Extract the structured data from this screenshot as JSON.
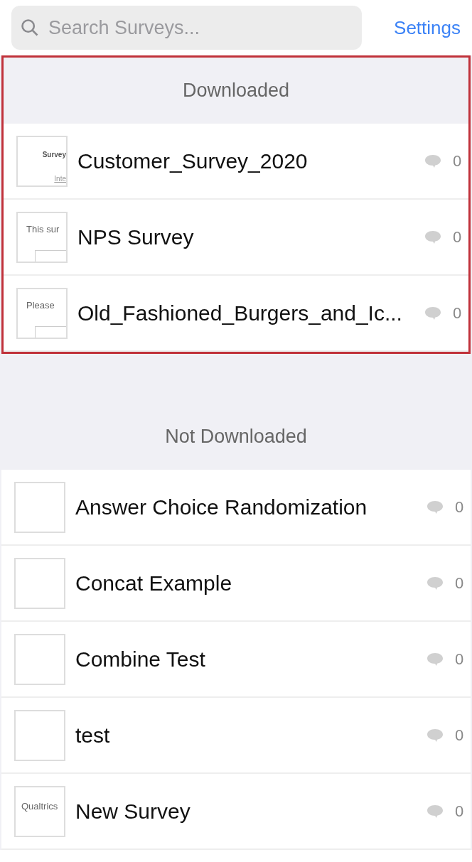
{
  "search": {
    "placeholder": "Search Surveys..."
  },
  "settings_link": "Settings",
  "sections": [
    {
      "title": "Downloaded",
      "highlighted": true,
      "surveys": [
        {
          "name": "Customer_Survey_2020",
          "comments": "0",
          "thumbnail": {
            "kind": "header",
            "lines": [
              "Survey",
              "Inte"
            ]
          }
        },
        {
          "name": "NPS Survey",
          "comments": "0",
          "thumbnail": {
            "kind": "form",
            "lines": [
              "This sur"
            ]
          }
        },
        {
          "name": "Old_Fashioned_Burgers_and_Ic...",
          "comments": "0",
          "thumbnail": {
            "kind": "form",
            "lines": [
              "Please"
            ]
          }
        }
      ]
    },
    {
      "title": "Not Downloaded",
      "highlighted": false,
      "surveys": [
        {
          "name": "Answer Choice Randomization",
          "comments": "0",
          "thumbnail": {
            "kind": "blank"
          }
        },
        {
          "name": "Concat Example",
          "comments": "0",
          "thumbnail": {
            "kind": "blank"
          }
        },
        {
          "name": "Combine Test",
          "comments": "0",
          "thumbnail": {
            "kind": "blank"
          }
        },
        {
          "name": "test",
          "comments": "0",
          "thumbnail": {
            "kind": "blank"
          }
        },
        {
          "name": "New Survey",
          "comments": "0",
          "thumbnail": {
            "kind": "plain",
            "lines": [
              "Qualtrics"
            ]
          }
        }
      ]
    }
  ]
}
